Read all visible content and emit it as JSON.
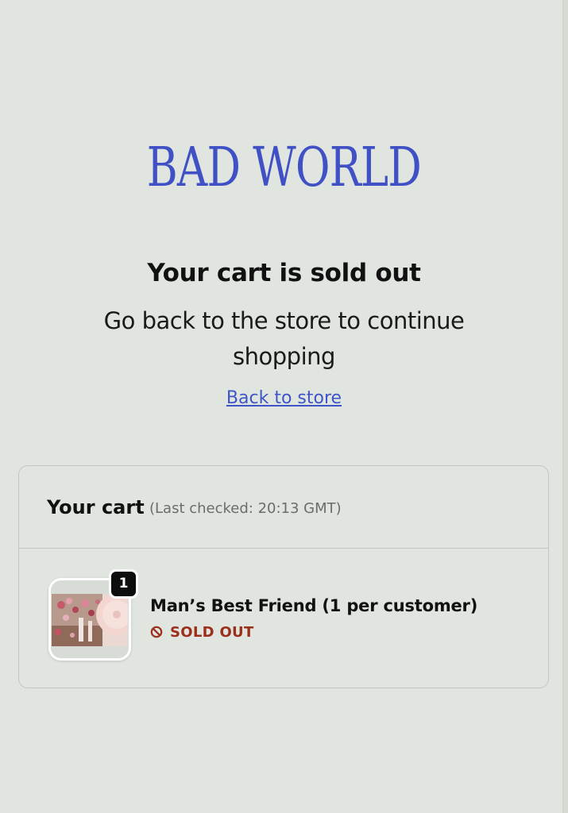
{
  "brand": {
    "logo_text": "BAD WORLD"
  },
  "status": {
    "heading": "Your cart is sold out",
    "message": "Go back to the store to continue shopping",
    "back_link": "Back to store"
  },
  "cart": {
    "title": "Your cart",
    "last_checked": "(Last checked: 20:13 GMT)",
    "items": [
      {
        "quantity": "1",
        "name": "Man’s Best Friend (1 per customer)",
        "status_label": "SOLD OUT",
        "status_icon": "ban-icon",
        "thumbnail_icon": "vinyl-record-with-flowers-photo"
      }
    ]
  },
  "colors": {
    "background": "#e1e5df",
    "brand_blue": "#3f51c4",
    "link": "#3e55c8",
    "sold_out": "#9b2f1c",
    "border": "#c3c7c1"
  }
}
